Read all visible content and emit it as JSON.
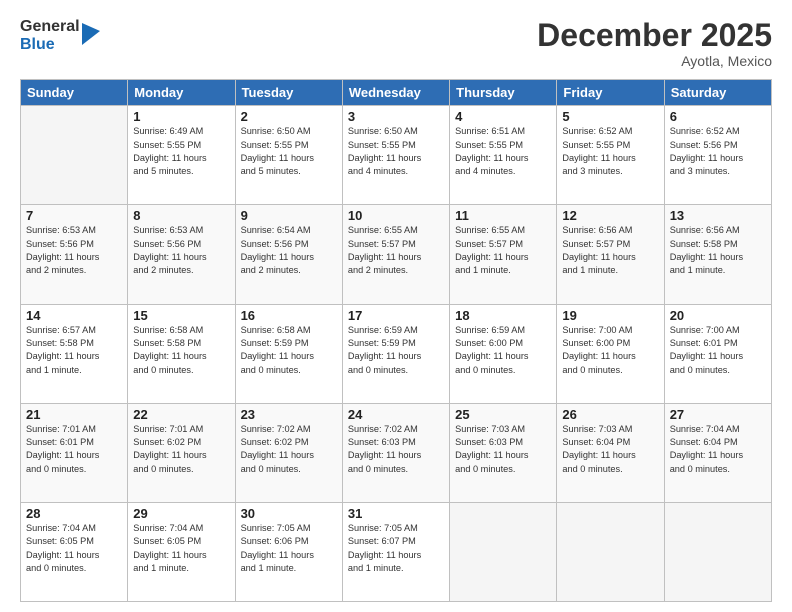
{
  "logo": {
    "general": "General",
    "blue": "Blue"
  },
  "header": {
    "month": "December 2025",
    "location": "Ayotla, Mexico"
  },
  "days_of_week": [
    "Sunday",
    "Monday",
    "Tuesday",
    "Wednesday",
    "Thursday",
    "Friday",
    "Saturday"
  ],
  "weeks": [
    [
      {
        "day": "",
        "info": ""
      },
      {
        "day": "1",
        "info": "Sunrise: 6:49 AM\nSunset: 5:55 PM\nDaylight: 11 hours\nand 5 minutes."
      },
      {
        "day": "2",
        "info": "Sunrise: 6:50 AM\nSunset: 5:55 PM\nDaylight: 11 hours\nand 5 minutes."
      },
      {
        "day": "3",
        "info": "Sunrise: 6:50 AM\nSunset: 5:55 PM\nDaylight: 11 hours\nand 4 minutes."
      },
      {
        "day": "4",
        "info": "Sunrise: 6:51 AM\nSunset: 5:55 PM\nDaylight: 11 hours\nand 4 minutes."
      },
      {
        "day": "5",
        "info": "Sunrise: 6:52 AM\nSunset: 5:55 PM\nDaylight: 11 hours\nand 3 minutes."
      },
      {
        "day": "6",
        "info": "Sunrise: 6:52 AM\nSunset: 5:56 PM\nDaylight: 11 hours\nand 3 minutes."
      }
    ],
    [
      {
        "day": "7",
        "info": "Sunrise: 6:53 AM\nSunset: 5:56 PM\nDaylight: 11 hours\nand 2 minutes."
      },
      {
        "day": "8",
        "info": "Sunrise: 6:53 AM\nSunset: 5:56 PM\nDaylight: 11 hours\nand 2 minutes."
      },
      {
        "day": "9",
        "info": "Sunrise: 6:54 AM\nSunset: 5:56 PM\nDaylight: 11 hours\nand 2 minutes."
      },
      {
        "day": "10",
        "info": "Sunrise: 6:55 AM\nSunset: 5:57 PM\nDaylight: 11 hours\nand 2 minutes."
      },
      {
        "day": "11",
        "info": "Sunrise: 6:55 AM\nSunset: 5:57 PM\nDaylight: 11 hours\nand 1 minute."
      },
      {
        "day": "12",
        "info": "Sunrise: 6:56 AM\nSunset: 5:57 PM\nDaylight: 11 hours\nand 1 minute."
      },
      {
        "day": "13",
        "info": "Sunrise: 6:56 AM\nSunset: 5:58 PM\nDaylight: 11 hours\nand 1 minute."
      }
    ],
    [
      {
        "day": "14",
        "info": "Sunrise: 6:57 AM\nSunset: 5:58 PM\nDaylight: 11 hours\nand 1 minute."
      },
      {
        "day": "15",
        "info": "Sunrise: 6:58 AM\nSunset: 5:58 PM\nDaylight: 11 hours\nand 0 minutes."
      },
      {
        "day": "16",
        "info": "Sunrise: 6:58 AM\nSunset: 5:59 PM\nDaylight: 11 hours\nand 0 minutes."
      },
      {
        "day": "17",
        "info": "Sunrise: 6:59 AM\nSunset: 5:59 PM\nDaylight: 11 hours\nand 0 minutes."
      },
      {
        "day": "18",
        "info": "Sunrise: 6:59 AM\nSunset: 6:00 PM\nDaylight: 11 hours\nand 0 minutes."
      },
      {
        "day": "19",
        "info": "Sunrise: 7:00 AM\nSunset: 6:00 PM\nDaylight: 11 hours\nand 0 minutes."
      },
      {
        "day": "20",
        "info": "Sunrise: 7:00 AM\nSunset: 6:01 PM\nDaylight: 11 hours\nand 0 minutes."
      }
    ],
    [
      {
        "day": "21",
        "info": "Sunrise: 7:01 AM\nSunset: 6:01 PM\nDaylight: 11 hours\nand 0 minutes."
      },
      {
        "day": "22",
        "info": "Sunrise: 7:01 AM\nSunset: 6:02 PM\nDaylight: 11 hours\nand 0 minutes."
      },
      {
        "day": "23",
        "info": "Sunrise: 7:02 AM\nSunset: 6:02 PM\nDaylight: 11 hours\nand 0 minutes."
      },
      {
        "day": "24",
        "info": "Sunrise: 7:02 AM\nSunset: 6:03 PM\nDaylight: 11 hours\nand 0 minutes."
      },
      {
        "day": "25",
        "info": "Sunrise: 7:03 AM\nSunset: 6:03 PM\nDaylight: 11 hours\nand 0 minutes."
      },
      {
        "day": "26",
        "info": "Sunrise: 7:03 AM\nSunset: 6:04 PM\nDaylight: 11 hours\nand 0 minutes."
      },
      {
        "day": "27",
        "info": "Sunrise: 7:04 AM\nSunset: 6:04 PM\nDaylight: 11 hours\nand 0 minutes."
      }
    ],
    [
      {
        "day": "28",
        "info": "Sunrise: 7:04 AM\nSunset: 6:05 PM\nDaylight: 11 hours\nand 0 minutes."
      },
      {
        "day": "29",
        "info": "Sunrise: 7:04 AM\nSunset: 6:05 PM\nDaylight: 11 hours\nand 1 minute."
      },
      {
        "day": "30",
        "info": "Sunrise: 7:05 AM\nSunset: 6:06 PM\nDaylight: 11 hours\nand 1 minute."
      },
      {
        "day": "31",
        "info": "Sunrise: 7:05 AM\nSunset: 6:07 PM\nDaylight: 11 hours\nand 1 minute."
      },
      {
        "day": "",
        "info": ""
      },
      {
        "day": "",
        "info": ""
      },
      {
        "day": "",
        "info": ""
      }
    ]
  ]
}
